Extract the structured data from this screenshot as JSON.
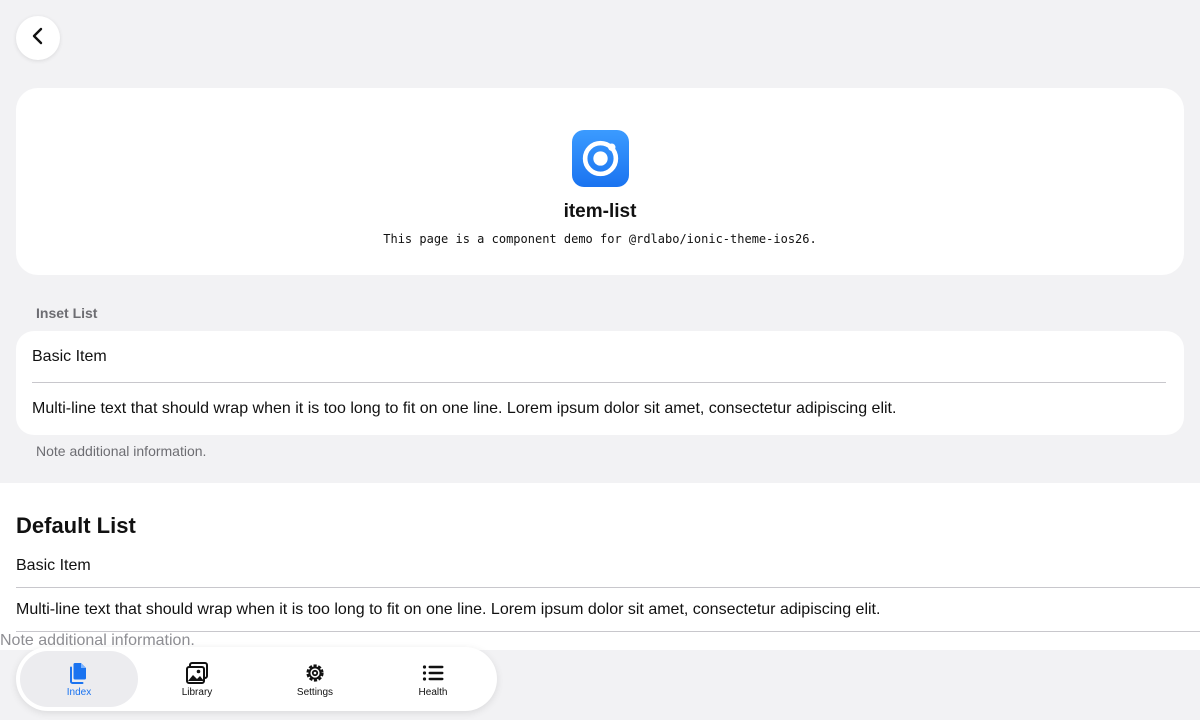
{
  "header": {
    "back_icon": "chevron-back-icon"
  },
  "hero": {
    "logo_icon": "ionic-logo-icon",
    "title": "item-list",
    "subtitle": "This page is a component demo for @rdlabo/ionic-theme-ios26."
  },
  "inset_list": {
    "header": "Inset List",
    "items": [
      {
        "label": "Basic Item"
      },
      {
        "label": "Multi-line text that should wrap when it is too long to fit on one line. Lorem ipsum dolor sit amet, consectetur adipiscing elit."
      }
    ],
    "note": "Note additional information."
  },
  "default_list": {
    "title": "Default List",
    "items": [
      {
        "label": "Basic Item"
      },
      {
        "label": "Multi-line text that should wrap when it is too long to fit on one line. Lorem ipsum dolor sit amet, consectetur adipiscing elit."
      }
    ],
    "note": "Note additional information."
  },
  "tab_bar": {
    "tabs": [
      {
        "label": "Index",
        "icon": "documents-icon",
        "active": true
      },
      {
        "label": "Library",
        "icon": "images-icon",
        "active": false
      },
      {
        "label": "Settings",
        "icon": "cog-icon",
        "active": false
      },
      {
        "label": "Health",
        "icon": "list-icon",
        "active": false
      }
    ]
  },
  "colors": {
    "accent": "#1a73f0",
    "background": "#f2f2f4",
    "card": "#ffffff",
    "secondary_text": "#6d6d72",
    "separator": "#c8c7cc"
  }
}
